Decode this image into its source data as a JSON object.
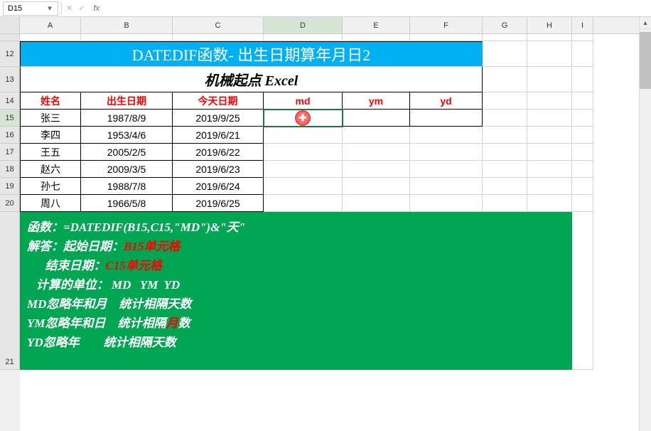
{
  "nameBox": "D15",
  "formulaBar": "",
  "columns": [
    "A",
    "B",
    "C",
    "D",
    "E",
    "F",
    "G",
    "H",
    "I"
  ],
  "rowNums": [
    "12",
    "13",
    "14",
    "15",
    "16",
    "17",
    "18",
    "19",
    "20",
    "21"
  ],
  "activeCol": "D",
  "activeRow": "15",
  "title": "DATEDIF函数- 出生日期算年月日2",
  "subtitle": "机械起点 Excel",
  "headers": {
    "name": "姓名",
    "birth": "出生日期",
    "today": "今天日期",
    "md": "md",
    "ym": "ym",
    "yd": "yd"
  },
  "rows": [
    {
      "name": "张三",
      "birth": "1987/8/9",
      "today": "2019/9/25"
    },
    {
      "name": "李四",
      "birth": "1953/4/6",
      "today": "2019/6/21"
    },
    {
      "name": "王五",
      "birth": "2005/2/5",
      "today": "2019/6/22"
    },
    {
      "name": "赵六",
      "birth": "2009/3/5",
      "today": "2019/6/23"
    },
    {
      "name": "孙七",
      "birth": "1988/7/8",
      "today": "2019/6/24"
    },
    {
      "name": "周八",
      "birth": "1966/5/8",
      "today": "2019/6/25"
    }
  ],
  "expl": {
    "l1a": "函数：",
    "l1b": "=DATEDIF(B15,C15,\"MD\")&\"天\"",
    "l2a": "解答：起始日期：",
    "l2b": "B15单元格",
    "l3a": "      结束日期：",
    "l3b": "C15单元格",
    "l4": "   计算的单位： MD   YM  YD",
    "l5": "MD忽略年和月    统计相隔天数",
    "l6a": "YM忽略年和日    统计相隔",
    "l6b": "月",
    "l6c": "数",
    "l7": "YD忽略年        统计相隔天数"
  }
}
